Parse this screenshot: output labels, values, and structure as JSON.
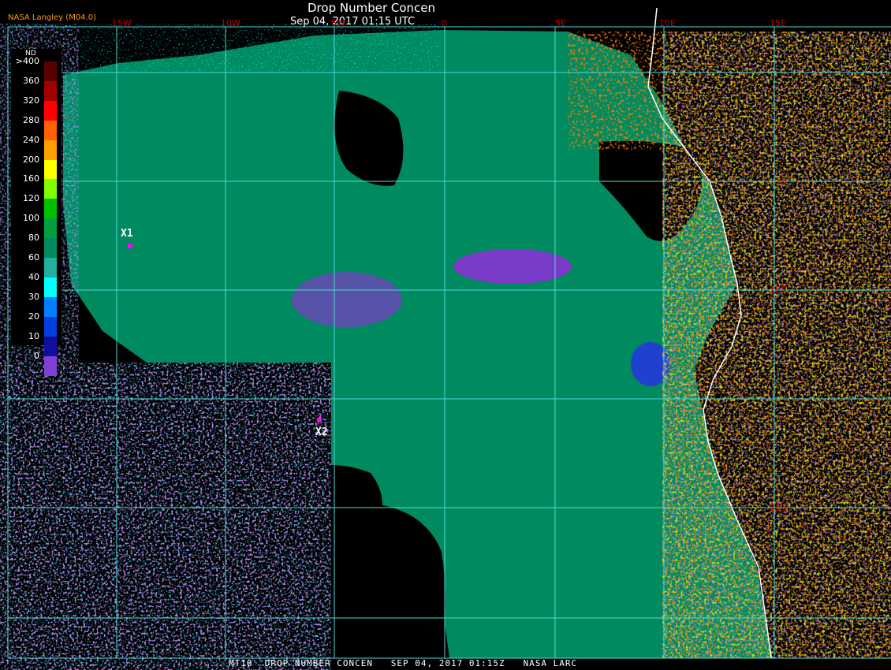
{
  "header": {
    "title": "Drop Number Concen",
    "subtitle": "Sep 04, 2017 01:15 UTC",
    "agency": "NASA Langley (M04.0)"
  },
  "footer": {
    "text": "MT10  DROP NUMBER CONCEN   SEP 04, 2017 01:15Z   NASA LARC"
  },
  "legend": {
    "unit": "ND",
    "levels": [
      {
        "label": ">400",
        "color": "#5a0000"
      },
      {
        "label": "360",
        "color": "#a00000"
      },
      {
        "label": "320",
        "color": "#ff0000"
      },
      {
        "label": "280",
        "color": "#ff6000"
      },
      {
        "label": "240",
        "color": "#ffa000"
      },
      {
        "label": "200",
        "color": "#ffff00"
      },
      {
        "label": "160",
        "color": "#80ff00"
      },
      {
        "label": "120",
        "color": "#00c000"
      },
      {
        "label": "100",
        "color": "#00a040"
      },
      {
        "label": "80",
        "color": "#008a60"
      },
      {
        "label": "60",
        "color": "#20b0a0"
      },
      {
        "label": "40",
        "color": "#00ffff"
      },
      {
        "label": "30",
        "color": "#0080ff"
      },
      {
        "label": "20",
        "color": "#0040e0"
      },
      {
        "label": "10",
        "color": "#1010a0"
      },
      {
        "label": "0",
        "color": "#8040d0"
      }
    ]
  },
  "grid": {
    "lon_labels": [
      "15W",
      "10W",
      "5W",
      "0",
      "5E",
      "10E",
      "15E"
    ],
    "lat_labels": [
      "5S",
      "10S",
      "20S"
    ]
  },
  "markers": [
    {
      "label": "X1",
      "color": "#ff00ff"
    },
    {
      "label": "X2",
      "color": "#ff00ff"
    }
  ],
  "colors": {
    "ocean_cloud": "#008a60",
    "clear_sky": "#000000",
    "gridline": "#4fd8d8",
    "coastline": "#ffffff"
  }
}
